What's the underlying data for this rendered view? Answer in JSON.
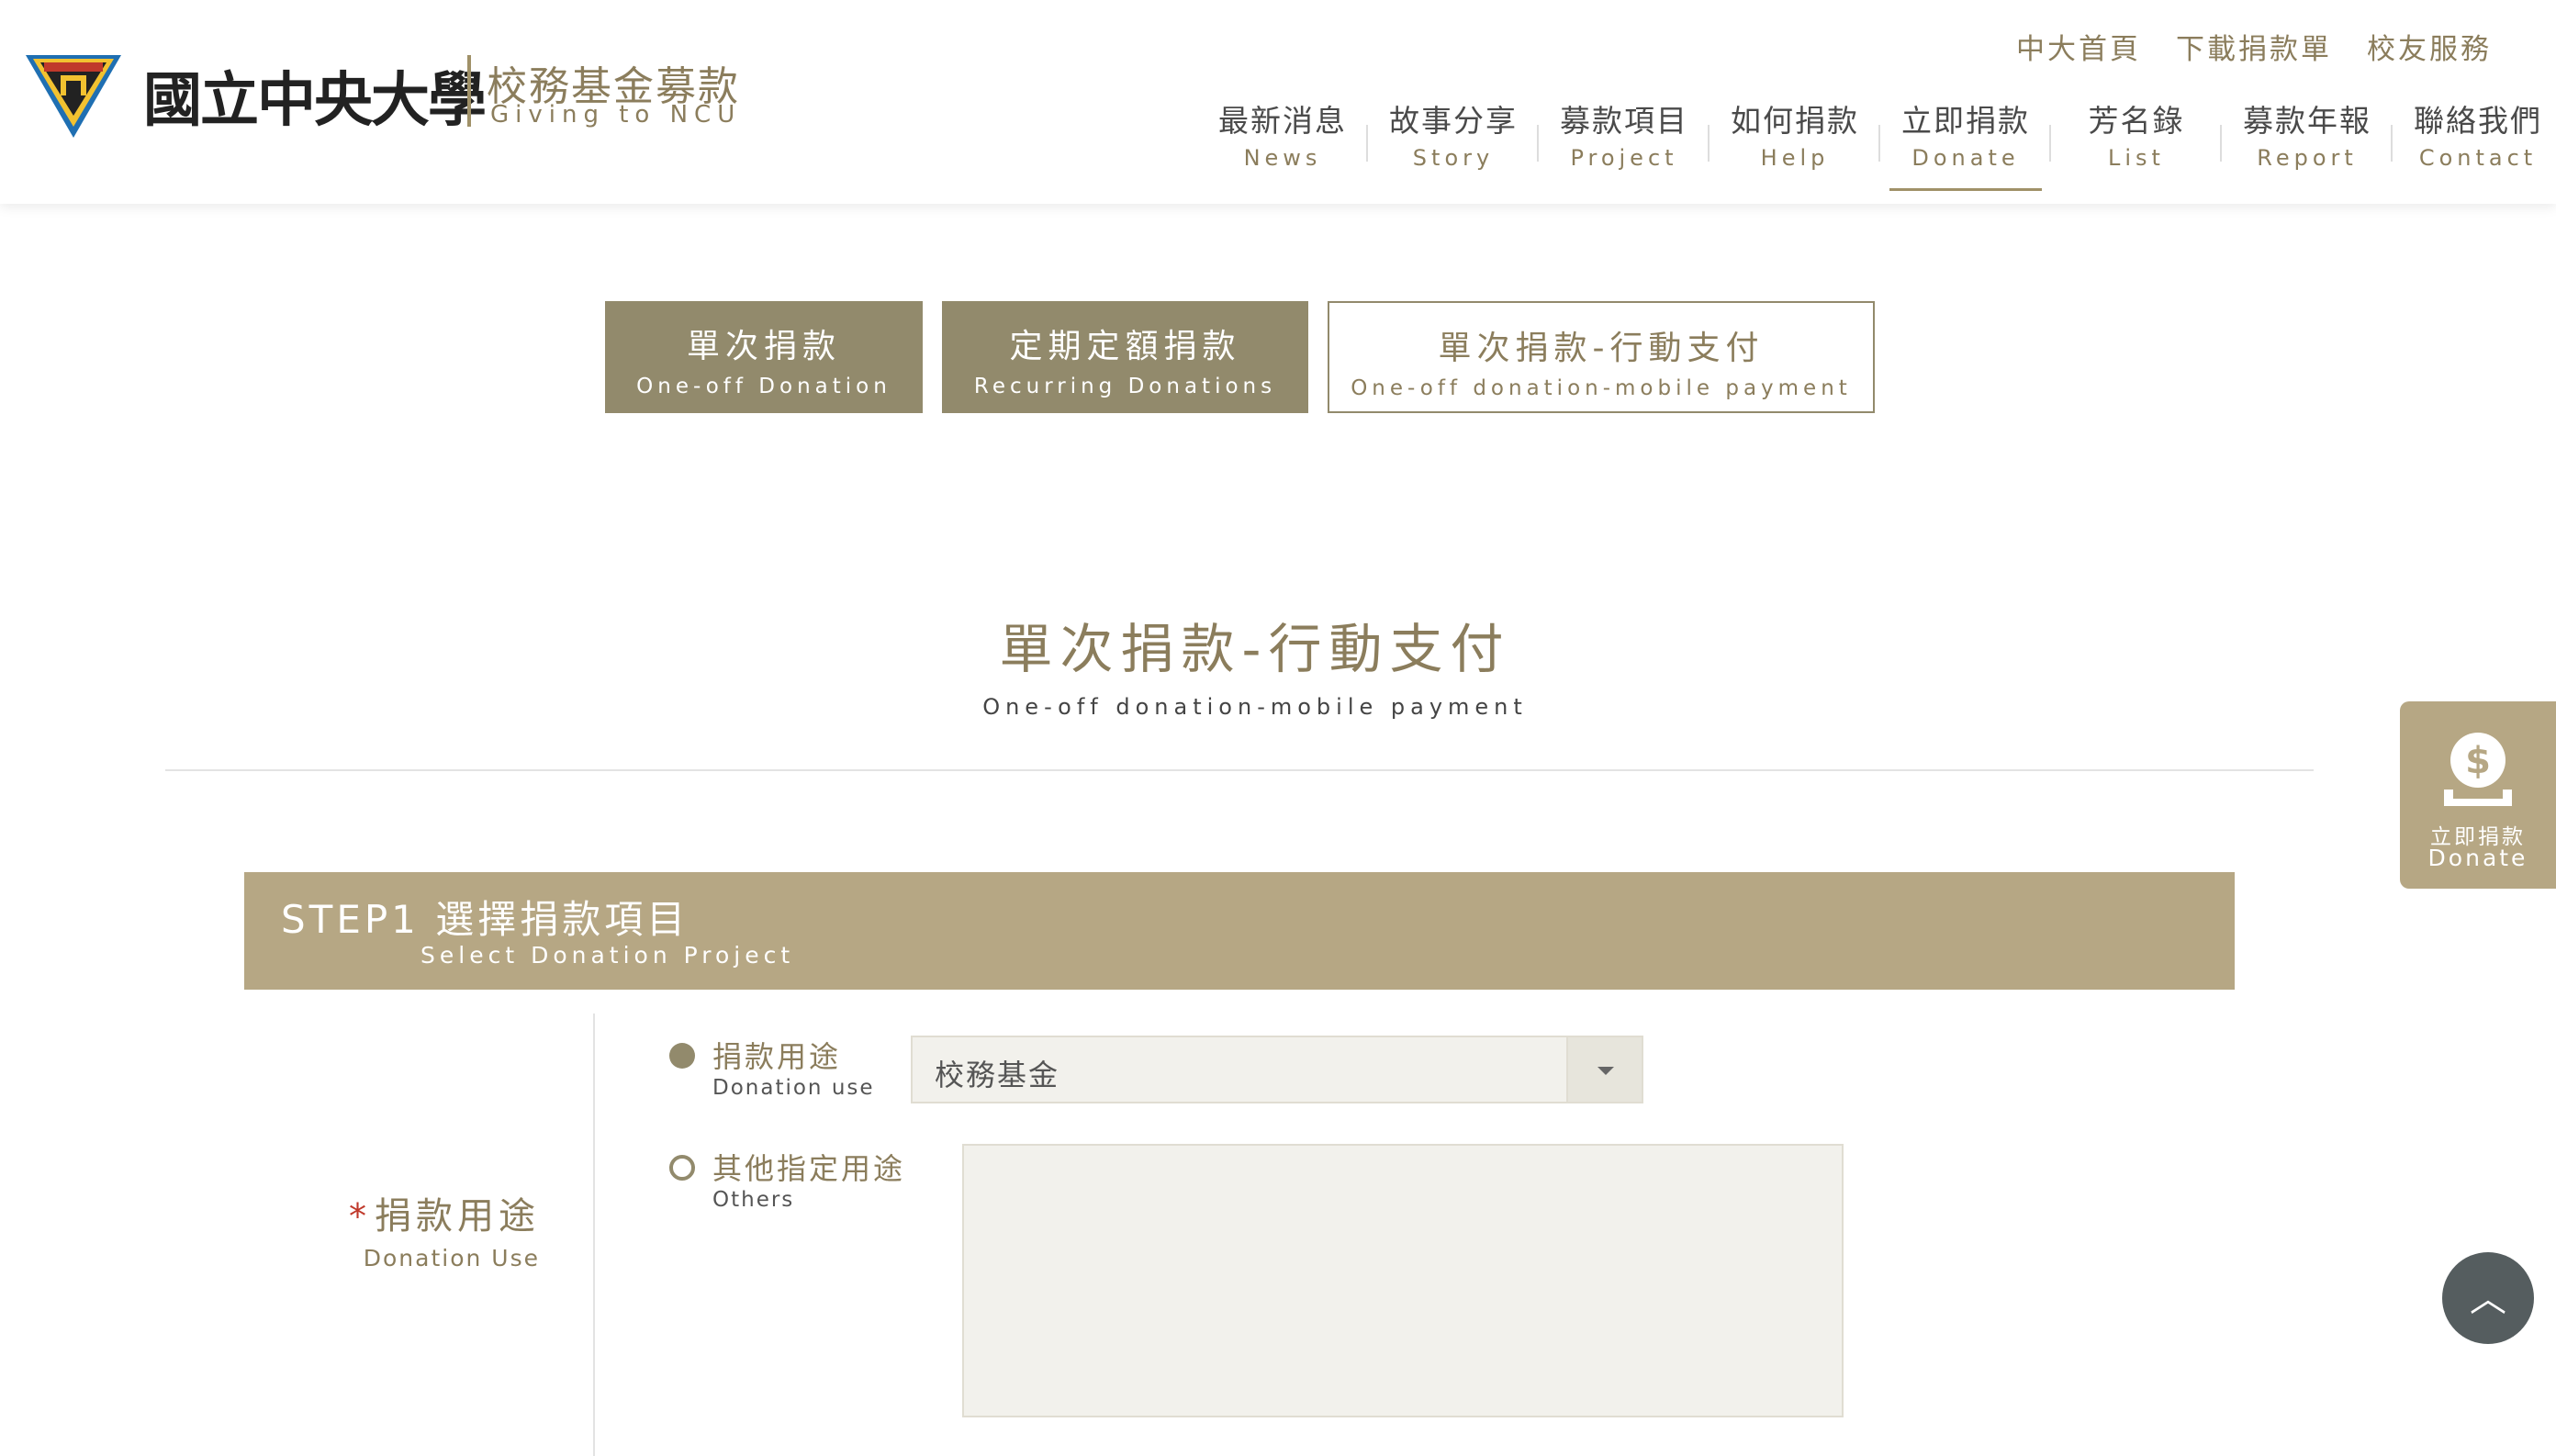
{
  "brand": {
    "name_cn": "國立中央大學",
    "sub_cn": "校務基金募款",
    "sub_en": "Giving to NCU"
  },
  "top_links": [
    "中大首頁",
    "下載捐款單",
    "校友服務"
  ],
  "nav": [
    {
      "cn": "最新消息",
      "en": "News"
    },
    {
      "cn": "故事分享",
      "en": "Story"
    },
    {
      "cn": "募款項目",
      "en": "Project"
    },
    {
      "cn": "如何捐款",
      "en": "Help"
    },
    {
      "cn": "立即捐款",
      "en": "Donate"
    },
    {
      "cn": "芳名錄",
      "en": "List"
    },
    {
      "cn": "募款年報",
      "en": "Report"
    },
    {
      "cn": "聯絡我們",
      "en": "Contact"
    }
  ],
  "active_nav": "Donate",
  "tabs": [
    {
      "cn": "單次捐款",
      "en": "One-off Donation"
    },
    {
      "cn": "定期定額捐款",
      "en": "Recurring Donations"
    },
    {
      "cn": "單次捐款-行動支付",
      "en": "One-off donation-mobile payment"
    }
  ],
  "page": {
    "title_cn": "單次捐款-行動支付",
    "title_en": "One-off donation-mobile payment"
  },
  "step1": {
    "title_cn": "STEP1 選擇捐款項目",
    "title_en": "Select Donation Project"
  },
  "form": {
    "label_star": "*",
    "label_cn": "捐款用途",
    "label_en": "Donation Use",
    "option1_cn": "捐款用途",
    "option1_en": "Donation use",
    "option1_selected": true,
    "select_value": "校務基金",
    "option2_cn": "其他指定用途",
    "option2_en": "Others",
    "option2_selected": false,
    "others_text": ""
  },
  "float_donate": {
    "cn": "立即捐款",
    "en": "Donate",
    "icon": "money-bag-icon"
  },
  "back_to_top": {
    "symbol": "︿",
    "icon": "chevron-up-icon"
  },
  "colors": {
    "accent": "#b6a784",
    "tab_fill": "#928a6c",
    "text_gold": "#8b7d5c"
  }
}
